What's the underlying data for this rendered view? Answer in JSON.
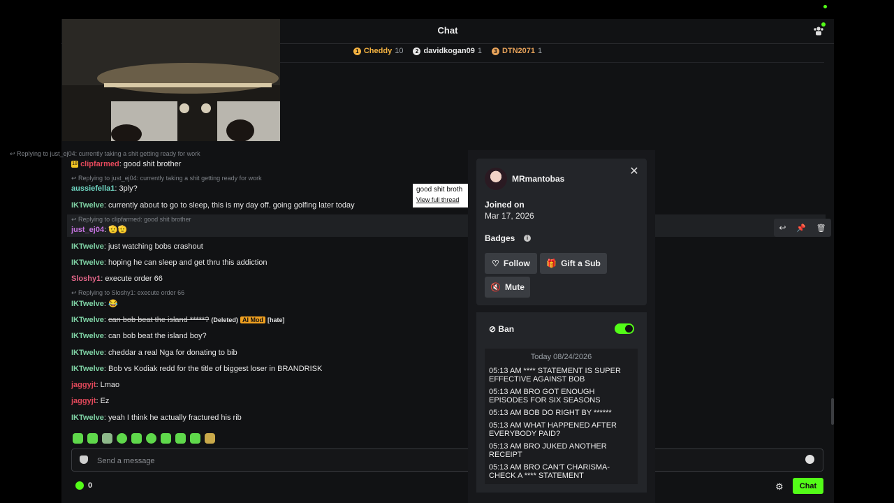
{
  "header": {
    "title": "Chat"
  },
  "leaderboard": [
    {
      "rank": "1",
      "name": "Cheddy",
      "count": "10",
      "color": "#f5b341"
    },
    {
      "rank": "2",
      "name": "davidkogan09",
      "count": "1",
      "color": "#e8e8e8"
    },
    {
      "rank": "3",
      "name": "DTN2071",
      "count": "1",
      "color": "#e8a35a"
    }
  ],
  "messages": {
    "m1_reply": "Replying to just_ej04: currently taking a shit getting ready for work",
    "m1_user": "clipfarmed",
    "m1_text": "good shit brother",
    "m2_reply": "Replying to just_ej04: currently taking a shit getting ready for work",
    "m2_user": "aussiefella1",
    "m2_text": "3ply?",
    "m3_user": "IKTwelve",
    "m3_text": "currently about to go to sleep, this is my day off. going golfing later today",
    "m4_reply": "Replying to clipfarmed: good shit brother",
    "m4_user": "just_ej04",
    "m4_text": "🫡🫡",
    "m5_user": "IKTwelve",
    "m5_text": "just watching bobs crashout",
    "m6_user": "IKTwelve",
    "m6_text": "hoping he can sleep and get thru this addiction",
    "m7_user": "Sloshy1",
    "m7_text": "execute order 66",
    "m8_reply": "Replying to Sloshy1: execute order 66",
    "m8_user": "IKTwelve",
    "m8_text": "😂",
    "m9_user": "IKTwelve",
    "m9_text": "can bob beat the island *****?",
    "m9_deleted": "(Deleted)",
    "m9_tag": "AI Mod",
    "m9_reason": "[hate]",
    "m10_user": "IKTwelve",
    "m10_text": "can bob beat the island boy?",
    "m11_user": "IKTwelve",
    "m11_text": "cheddar a real Nga for donating to bib",
    "m12_user": "IKTwelve",
    "m12_text": "Bob vs Kodiak redd for the title of biggest loser in BRANDRISK",
    "m13_user": "jaggyjt",
    "m13_text": "Lmao",
    "m14_user": "jaggyjt",
    "m14_text": "Ez",
    "m15_user": "IKTwelve",
    "m15_text": "yeah I think he actually fractured his rib",
    "sep": ": "
  },
  "tooltip": {
    "text": "good shit broth",
    "link": "View full thread"
  },
  "input": {
    "placeholder": "Send a message"
  },
  "bottom": {
    "points": "0",
    "chat_label": "Chat"
  },
  "profile": {
    "username": "MRmantobas",
    "joined_label": "Joined on",
    "joined_date": "Mar 17, 2026",
    "badges_label": "Badges",
    "follow": "Follow",
    "gift": "Gift a Sub",
    "mute": "Mute",
    "ban_label": "Ban",
    "log_date": "Today 08/24/2026",
    "log": [
      "05:13 AM **** STATEMENT IS SUPER EFFECTIVE AGAINST BOB",
      "05:13 AM BRO GOT ENOUGH EPISODES FOR SIX SEASONS",
      "05:13 AM BOB DO RIGHT BY ******",
      "05:13 AM WHAT HAPPENED AFTER EVERYBODY PAID?",
      "05:13 AM BRO JUKED ANOTHER RECEIPT",
      "05:13 AM BRO CAN'T CHARISMA-CHECK A **** STATEMENT"
    ]
  },
  "colors": {
    "accent": "#53fc18",
    "ai_mod": "#f0a020"
  }
}
